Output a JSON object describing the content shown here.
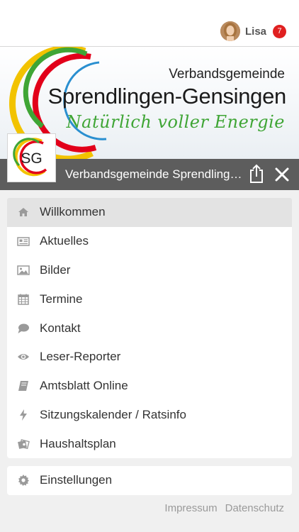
{
  "user": {
    "name": "Lisa",
    "notification_count": "7"
  },
  "banner": {
    "line1": "Verbandsgemeinde",
    "line2": "Sprendlingen-Gensingen",
    "slogan": "Natürlich voller Energie"
  },
  "logo": {
    "text": "SG"
  },
  "header": {
    "title": "Verbandsgemeinde Sprendlingen-Gensingen"
  },
  "menu": {
    "items": [
      {
        "label": "Willkommen",
        "icon": "home-icon"
      },
      {
        "label": "Aktuelles",
        "icon": "newspaper-icon"
      },
      {
        "label": "Bilder",
        "icon": "image-icon"
      },
      {
        "label": "Termine",
        "icon": "calendar-icon"
      },
      {
        "label": "Kontakt",
        "icon": "chat-bubble-icon"
      },
      {
        "label": "Leser-Reporter",
        "icon": "eye-icon"
      },
      {
        "label": "Amtsblatt Online",
        "icon": "book-icon"
      },
      {
        "label": "Sitzungskalender / Ratsinfo",
        "icon": "lightning-icon"
      },
      {
        "label": "Haushaltsplan",
        "icon": "money-icon"
      }
    ],
    "settings": {
      "label": "Einstellungen",
      "icon": "gear-icon"
    }
  },
  "footer": {
    "impressum": "Impressum",
    "datenschutz": "Datenschutz"
  },
  "colors": {
    "header_bar": "#5d5d5d",
    "badge": "#e02020",
    "slogan_green": "#3fa535",
    "active_item": "#e3e3e3",
    "icon_gray": "#9a9a9a"
  }
}
